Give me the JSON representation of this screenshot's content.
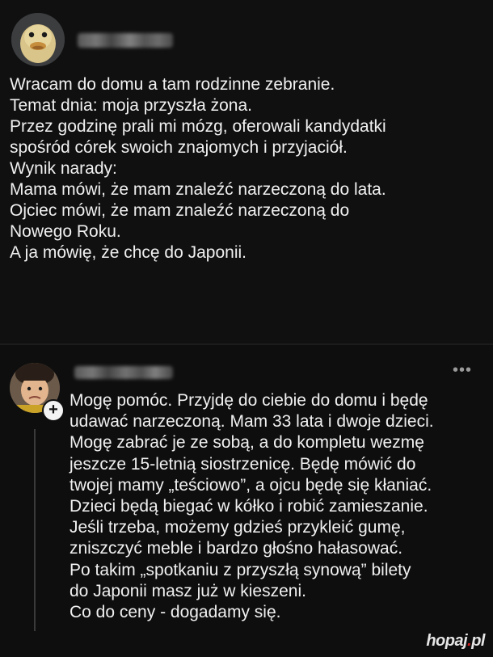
{
  "post": {
    "author_avatar_icon": "duckling-avatar-icon",
    "author_name_blurred": "",
    "lines": [
      "Wracam do domu a tam rodzinne zebranie.",
      "Temat dnia: moja przyszła żona.",
      "Przez godzinę prali mi mózg, oferowali kandydatki",
      "spośród córek swoich znajomych i przyjaciół.",
      "Wynik narady:",
      "Mama mówi, że mam znaleźć narzeczoną do lata.",
      "Ojciec mówi, że mam znaleźć narzeczoną do",
      "Nowego Roku.",
      "A ja mówię, że chcę do Japonii."
    ]
  },
  "comment": {
    "author_avatar_icon": "child-avatar-icon",
    "author_name_blurred": "",
    "plus_badge": "+",
    "more_menu": "•••",
    "lines": [
      "Mogę pomóc. Przyjdę do ciebie do domu i będę",
      "udawać narzeczoną. Mam 33 lata i dwoje dzieci.",
      "Mogę zabrać je ze sobą, a do kompletu wezmę",
      "jeszcze 15-letnią siostrzenicę. Będę mówić do",
      "twojej mamy „teściowo”, a ojcu będę się kłaniać.",
      "Dzieci będą biegać w kółko i robić zamieszanie.",
      "Jeśli trzeba, możemy gdzieś przykleić gumę,",
      "zniszczyć meble i bardzo głośno hałasować.",
      "Po takim „spotkaniu z przyszłą synową” bilety",
      "do Japonii masz już w kieszeni.",
      "Co do ceny - dogadamy się."
    ]
  },
  "watermark": {
    "text_main": "hopaj",
    "text_dot": ".",
    "text_tld": "pl"
  },
  "colors": {
    "background": "#0f0f0f",
    "text": "#f0f0f0",
    "watermark_accent": "#d21e1e"
  }
}
